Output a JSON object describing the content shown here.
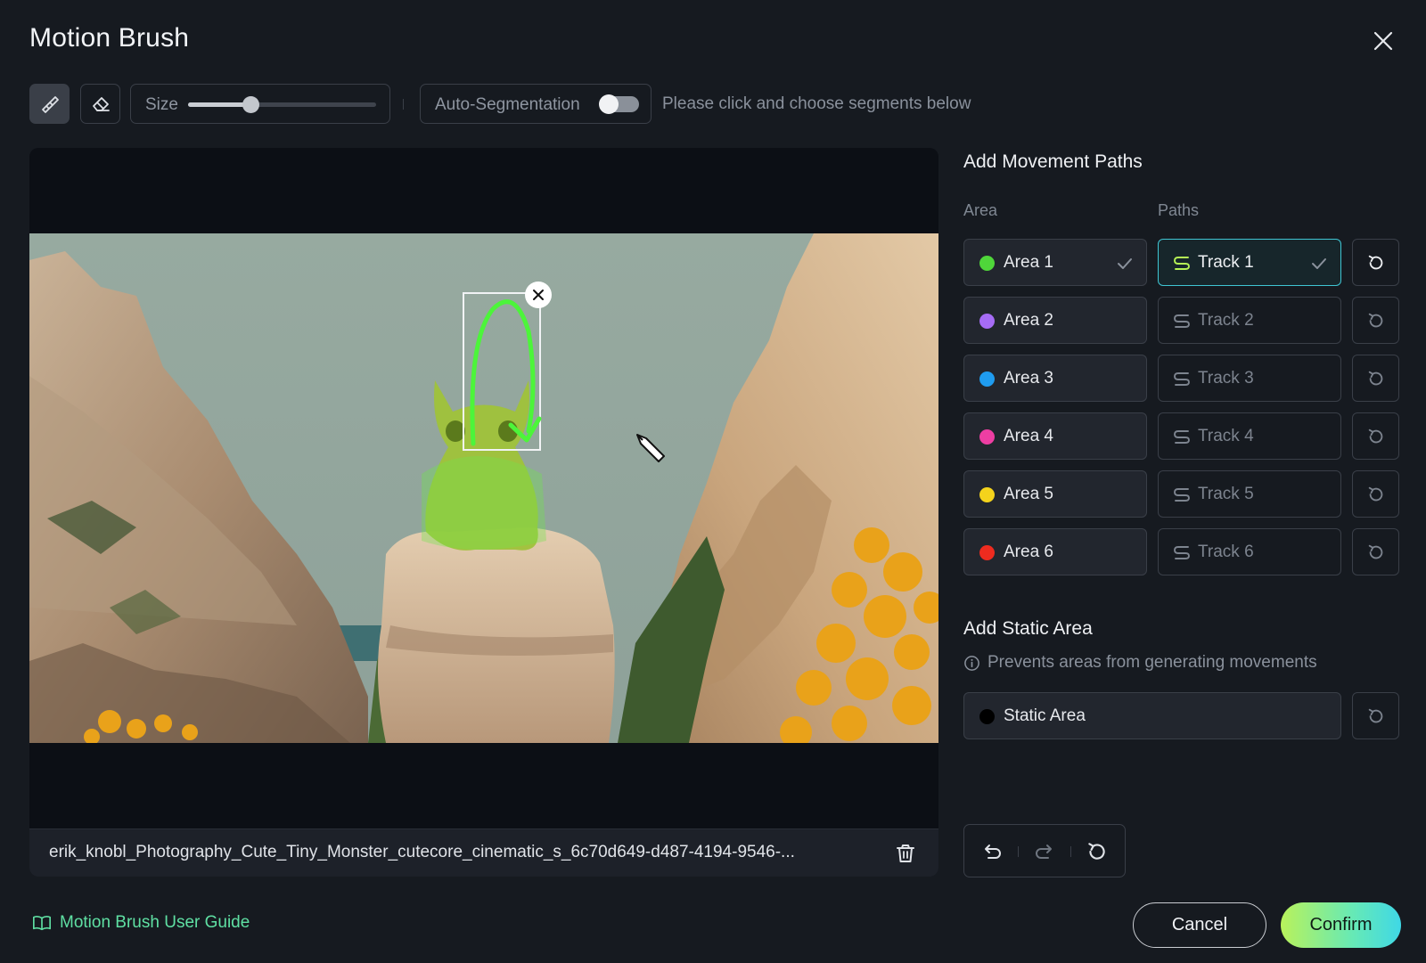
{
  "dialog": {
    "title": "Motion Brush"
  },
  "toolbar": {
    "size_label": "Size",
    "size_value_percent": 33,
    "auto_seg_label": "Auto-Segmentation",
    "auto_seg_on": false,
    "hint": "Please click and choose segments below"
  },
  "canvas": {
    "file_name": "erik_knobl_Photography_Cute_Tiny_Monster_cutecore_cinematic_s_6c70d649-d487-4194-9546-..."
  },
  "movement": {
    "title": "Add Movement Paths",
    "area_header": "Area",
    "paths_header": "Paths",
    "areas": [
      {
        "label": "Area 1",
        "color": "#4fd63a",
        "checked": true
      },
      {
        "label": "Area 2",
        "color": "#a66cf5"
      },
      {
        "label": "Area 3",
        "color": "#1f9cf0"
      },
      {
        "label": "Area 4",
        "color": "#ee3ea3"
      },
      {
        "label": "Area 5",
        "color": "#f4d31c"
      },
      {
        "label": "Area 6",
        "color": "#ee2b1f"
      }
    ],
    "tracks": [
      {
        "label": "Track 1",
        "active": true
      },
      {
        "label": "Track 2"
      },
      {
        "label": "Track 3"
      },
      {
        "label": "Track 4"
      },
      {
        "label": "Track 5"
      },
      {
        "label": "Track 6"
      }
    ]
  },
  "static": {
    "title": "Add Static Area",
    "description": "Prevents areas from generating movements",
    "label": "Static Area",
    "color": "#000000"
  },
  "footer": {
    "guide_label": "Motion Brush User Guide",
    "cancel_label": "Cancel",
    "confirm_label": "Confirm"
  },
  "colors": {
    "accent_green": "#5fe0a3",
    "track_active_border": "#3fc5d3",
    "brush_stroke": "#4cf53a"
  }
}
